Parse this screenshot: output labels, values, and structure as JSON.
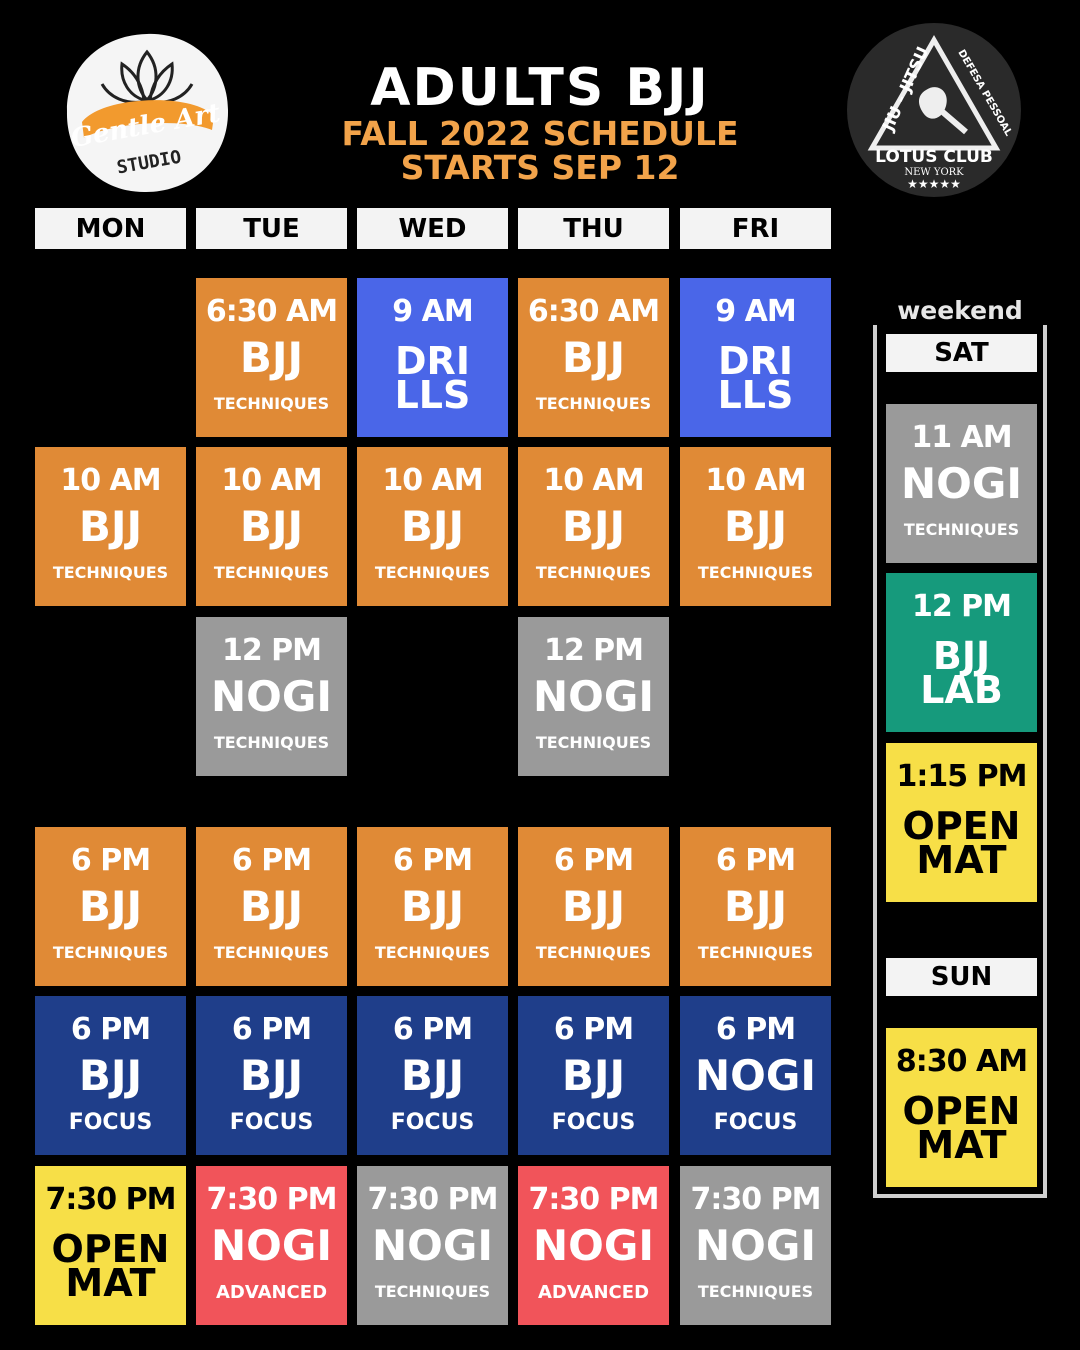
{
  "header": {
    "title": "ADULTS BJJ",
    "subtitle_line1": "FALL 2022 SCHEDULE",
    "subtitle_line2": "STARTS  SEP 12"
  },
  "logos": {
    "left": {
      "script_text": "Gentle Art",
      "sub_text": "STUDIO"
    },
    "right": {
      "arc_left": "JIU - JITSU",
      "arc_right": "DEFESA PESSOAL",
      "name": "LOTUS CLUB",
      "city": "NEW YORK",
      "stars": "★★★★★"
    }
  },
  "days": [
    "MON",
    "TUE",
    "WED",
    "THU",
    "FRI"
  ],
  "classes": {
    "tue_630": {
      "time": "6:30 AM",
      "name": "BJJ",
      "sub": "TECHNIQUES"
    },
    "wed_9": {
      "time": "9 AM",
      "name": "DRI\nLLS",
      "sub": ""
    },
    "thu_630": {
      "time": "6:30 AM",
      "name": "BJJ",
      "sub": "TECHNIQUES"
    },
    "fri_9": {
      "time": "9 AM",
      "name": "DRI\nLLS",
      "sub": ""
    },
    "mon_10": {
      "time": "10 AM",
      "name": "BJJ",
      "sub": "TECHNIQUES"
    },
    "tue_10": {
      "time": "10 AM",
      "name": "BJJ",
      "sub": "TECHNIQUES"
    },
    "wed_10": {
      "time": "10 AM",
      "name": "BJJ",
      "sub": "TECHNIQUES"
    },
    "thu_10": {
      "time": "10 AM",
      "name": "BJJ",
      "sub": "TECHNIQUES"
    },
    "fri_10": {
      "time": "10 AM",
      "name": "BJJ",
      "sub": "TECHNIQUES"
    },
    "tue_12": {
      "time": "12 PM",
      "name": "NOGI",
      "sub": "TECHNIQUES"
    },
    "thu_12": {
      "time": "12 PM",
      "name": "NOGI",
      "sub": "TECHNIQUES"
    },
    "mon_6a": {
      "time": "6 PM",
      "name": "BJJ",
      "sub": "TECHNIQUES"
    },
    "tue_6a": {
      "time": "6 PM",
      "name": "BJJ",
      "sub": "TECHNIQUES"
    },
    "wed_6a": {
      "time": "6 PM",
      "name": "BJJ",
      "sub": "TECHNIQUES"
    },
    "thu_6a": {
      "time": "6 PM",
      "name": "BJJ",
      "sub": "TECHNIQUES"
    },
    "fri_6a": {
      "time": "6 PM",
      "name": "BJJ",
      "sub": "TECHNIQUES"
    },
    "mon_6b": {
      "time": "6 PM",
      "name": "BJJ",
      "sub": "FOCUS"
    },
    "tue_6b": {
      "time": "6 PM",
      "name": "BJJ",
      "sub": "FOCUS"
    },
    "wed_6b": {
      "time": "6 PM",
      "name": "BJJ",
      "sub": "FOCUS"
    },
    "thu_6b": {
      "time": "6 PM",
      "name": "BJJ",
      "sub": "FOCUS"
    },
    "fri_6b": {
      "time": "6 PM",
      "name": "NOGI",
      "sub": "FOCUS"
    },
    "mon_730": {
      "time": "7:30 PM",
      "name": "OPEN\nMAT",
      "sub": ""
    },
    "tue_730": {
      "time": "7:30 PM",
      "name": "NOGI",
      "sub": "ADVANCED"
    },
    "wed_730": {
      "time": "7:30 PM",
      "name": "NOGI",
      "sub": "TECHNIQUES"
    },
    "thu_730": {
      "time": "7:30 PM",
      "name": "NOGI",
      "sub": "ADVANCED"
    },
    "fri_730": {
      "time": "7:30 PM",
      "name": "NOGI",
      "sub": "TECHNIQUES"
    }
  },
  "weekend": {
    "label": "weekend",
    "sat": "SAT",
    "sun": "SUN",
    "sat_11": {
      "time": "11 AM",
      "name": "NOGI",
      "sub": "TECHNIQUES"
    },
    "sat_12": {
      "time": "12 PM",
      "name": "BJJ\nLAB",
      "sub": ""
    },
    "sat_115": {
      "time": "1:15 PM",
      "name": "OPEN\nMAT",
      "sub": ""
    },
    "sun_830": {
      "time": "8:30 AM",
      "name": "OPEN\nMAT",
      "sub": ""
    }
  },
  "colors": {
    "techniques": "#e08a36",
    "drills": "#4a66e8",
    "focus": "#1f3e8a",
    "nogi": "#9a9a9a",
    "open_mat": "#f7df47",
    "advanced": "#f1545a",
    "lab": "#169a7c",
    "subtitle": "#f2a34a"
  }
}
